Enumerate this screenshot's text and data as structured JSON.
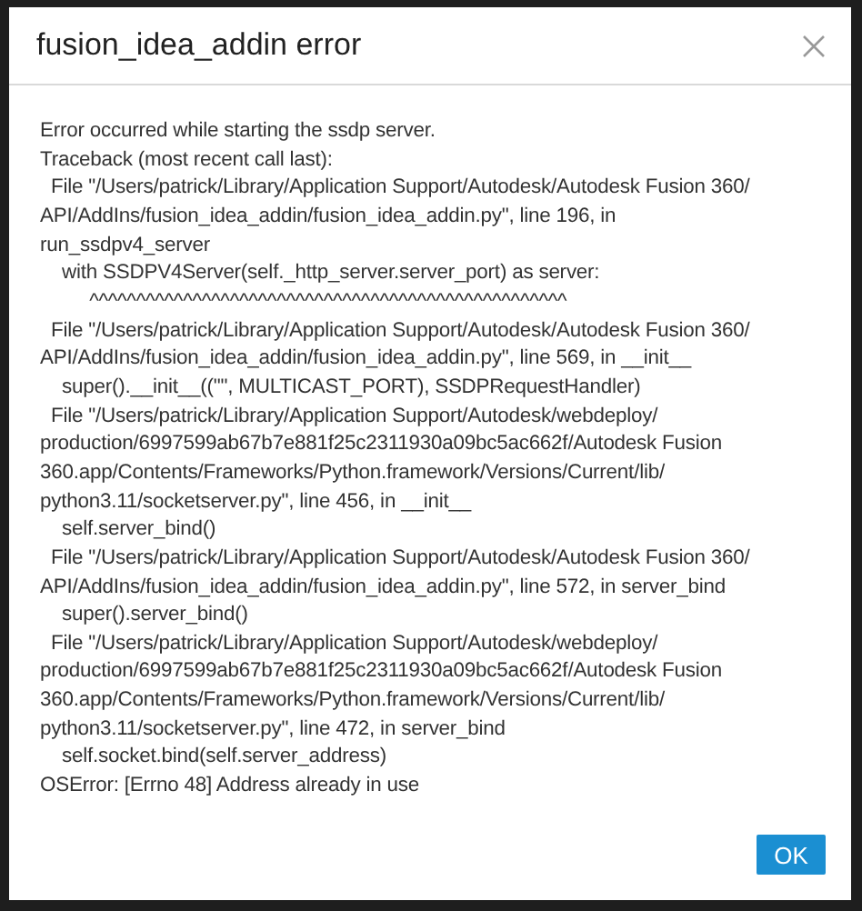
{
  "dialog": {
    "title": "fusion_idea_addin error",
    "message_lines": [
      "Error occurred while starting the ssdp server.",
      "Traceback (most recent call last):",
      "  File \"/Users/patrick/Library/Application Support/Autodesk/Autodesk Fusion 360/",
      "API/AddIns/fusion_idea_addin/fusion_idea_addin.py\", line 196, in",
      "run_ssdpv4_server",
      "    with SSDPV4Server(self._http_server.server_port) as server:",
      "         ^^^^^^^^^^^^^^^^^^^^^^^^^^^^^^^^^^^^^^^^^^^^^^^^^^^",
      "  File \"/Users/patrick/Library/Application Support/Autodesk/Autodesk Fusion 360/",
      "API/AddIns/fusion_idea_addin/fusion_idea_addin.py\", line 569, in __init__",
      "    super().__init__((\"\", MULTICAST_PORT), SSDPRequestHandler)",
      "  File \"/Users/patrick/Library/Application Support/Autodesk/webdeploy/",
      "production/6997599ab67b7e881f25c2311930a09bc5ac662f/Autodesk Fusion",
      "360.app/Contents/Frameworks/Python.framework/Versions/Current/lib/",
      "python3.11/socketserver.py\", line 456, in __init__",
      "    self.server_bind()",
      "  File \"/Users/patrick/Library/Application Support/Autodesk/Autodesk Fusion 360/",
      "API/AddIns/fusion_idea_addin/fusion_idea_addin.py\", line 572, in server_bind",
      "    super().server_bind()",
      "  File \"/Users/patrick/Library/Application Support/Autodesk/webdeploy/",
      "production/6997599ab67b7e881f25c2311930a09bc5ac662f/Autodesk Fusion",
      "360.app/Contents/Frameworks/Python.framework/Versions/Current/lib/",
      "python3.11/socketserver.py\", line 472, in server_bind",
      "    self.socket.bind(self.server_address)",
      "OSError: [Errno 48] Address already in use"
    ],
    "buttons": [
      "OK"
    ]
  }
}
